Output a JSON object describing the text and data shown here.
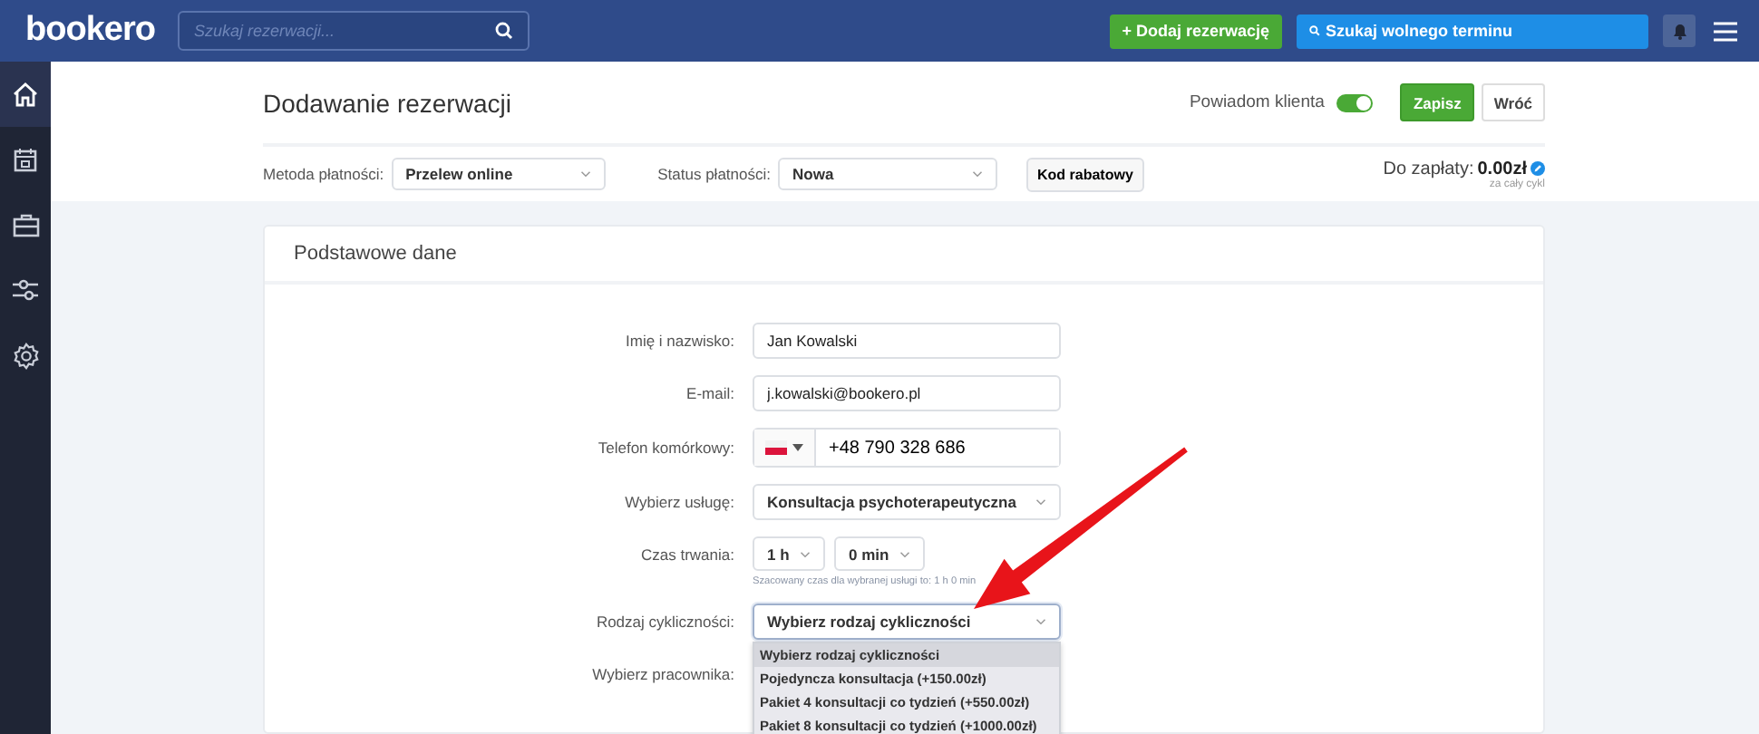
{
  "topbar": {
    "logo": "bookero",
    "search": {
      "placeholder": "Szukaj rezerwacji..."
    },
    "buttons": [
      {
        "kind": "add",
        "label": "+ Dodaj rezerwację"
      },
      {
        "kind": "search",
        "label": "Szukaj wolnego terminu"
      }
    ]
  },
  "sidebar": {
    "items": [
      {
        "kind": "home",
        "selected": true
      },
      {
        "kind": "calendar",
        "selected": false
      },
      {
        "kind": "briefcase",
        "selected": false
      },
      {
        "kind": "sliders",
        "selected": false
      },
      {
        "kind": "settings",
        "selected": false
      }
    ]
  },
  "header": {
    "title": "Dodawanie rezerwacji",
    "notify": {
      "label": "Powiadom klienta",
      "on": true
    },
    "buttons": [
      {
        "kind": "primary",
        "label": "Zapisz"
      },
      {
        "kind": "default",
        "label": "Wróć"
      }
    ],
    "payment_method": {
      "label": "Metoda płatności:",
      "value": "Przelew online"
    },
    "payment_status": {
      "label": "Status płatności:",
      "value": "Nowa"
    },
    "discount_button": "Kod rabatowy",
    "total": {
      "label": "Do zapłaty:",
      "amount": "0.00zł",
      "note": "za cały cykl"
    }
  },
  "card": {
    "title": "Podstawowe dane",
    "fields": [
      {
        "kind": "text",
        "label": "Imię i nazwisko:",
        "value": "Jan Kowalski"
      },
      {
        "kind": "text",
        "label": "E-mail:",
        "value": "j.kowalski@bookero.pl"
      },
      {
        "kind": "phone",
        "label": "Telefon komórkowy:",
        "value": "+48 790 328 686"
      },
      {
        "kind": "select",
        "label": "Wybierz usługę:",
        "value": "Konsultacja psychoterapeutyczna"
      },
      {
        "kind": "duration",
        "label": "Czas trwania:",
        "hours": "1 h",
        "minutes": "0 min",
        "hint": "Szacowany czas dla wybranej usługi to: 1 h 0 min"
      },
      {
        "kind": "select",
        "label": "Rodzaj cykliczności:",
        "value": "Wybierz rodzaj cykliczności",
        "expanded": true,
        "options": [
          {
            "label": "Wybierz rodzaj cykliczności",
            "selected": true
          },
          {
            "label": "Pojedyncza konsultacja (+150.00zł)",
            "selected": false
          },
          {
            "label": "Pakiet 4 konsultacji co tydzień (+550.00zł)",
            "selected": false
          },
          {
            "label": "Pakiet 8 konsultacji co tydzień (+1000.00zł)",
            "selected": false
          }
        ]
      },
      {
        "kind": "covered",
        "label": "Wybierz pracownika:"
      }
    ]
  }
}
